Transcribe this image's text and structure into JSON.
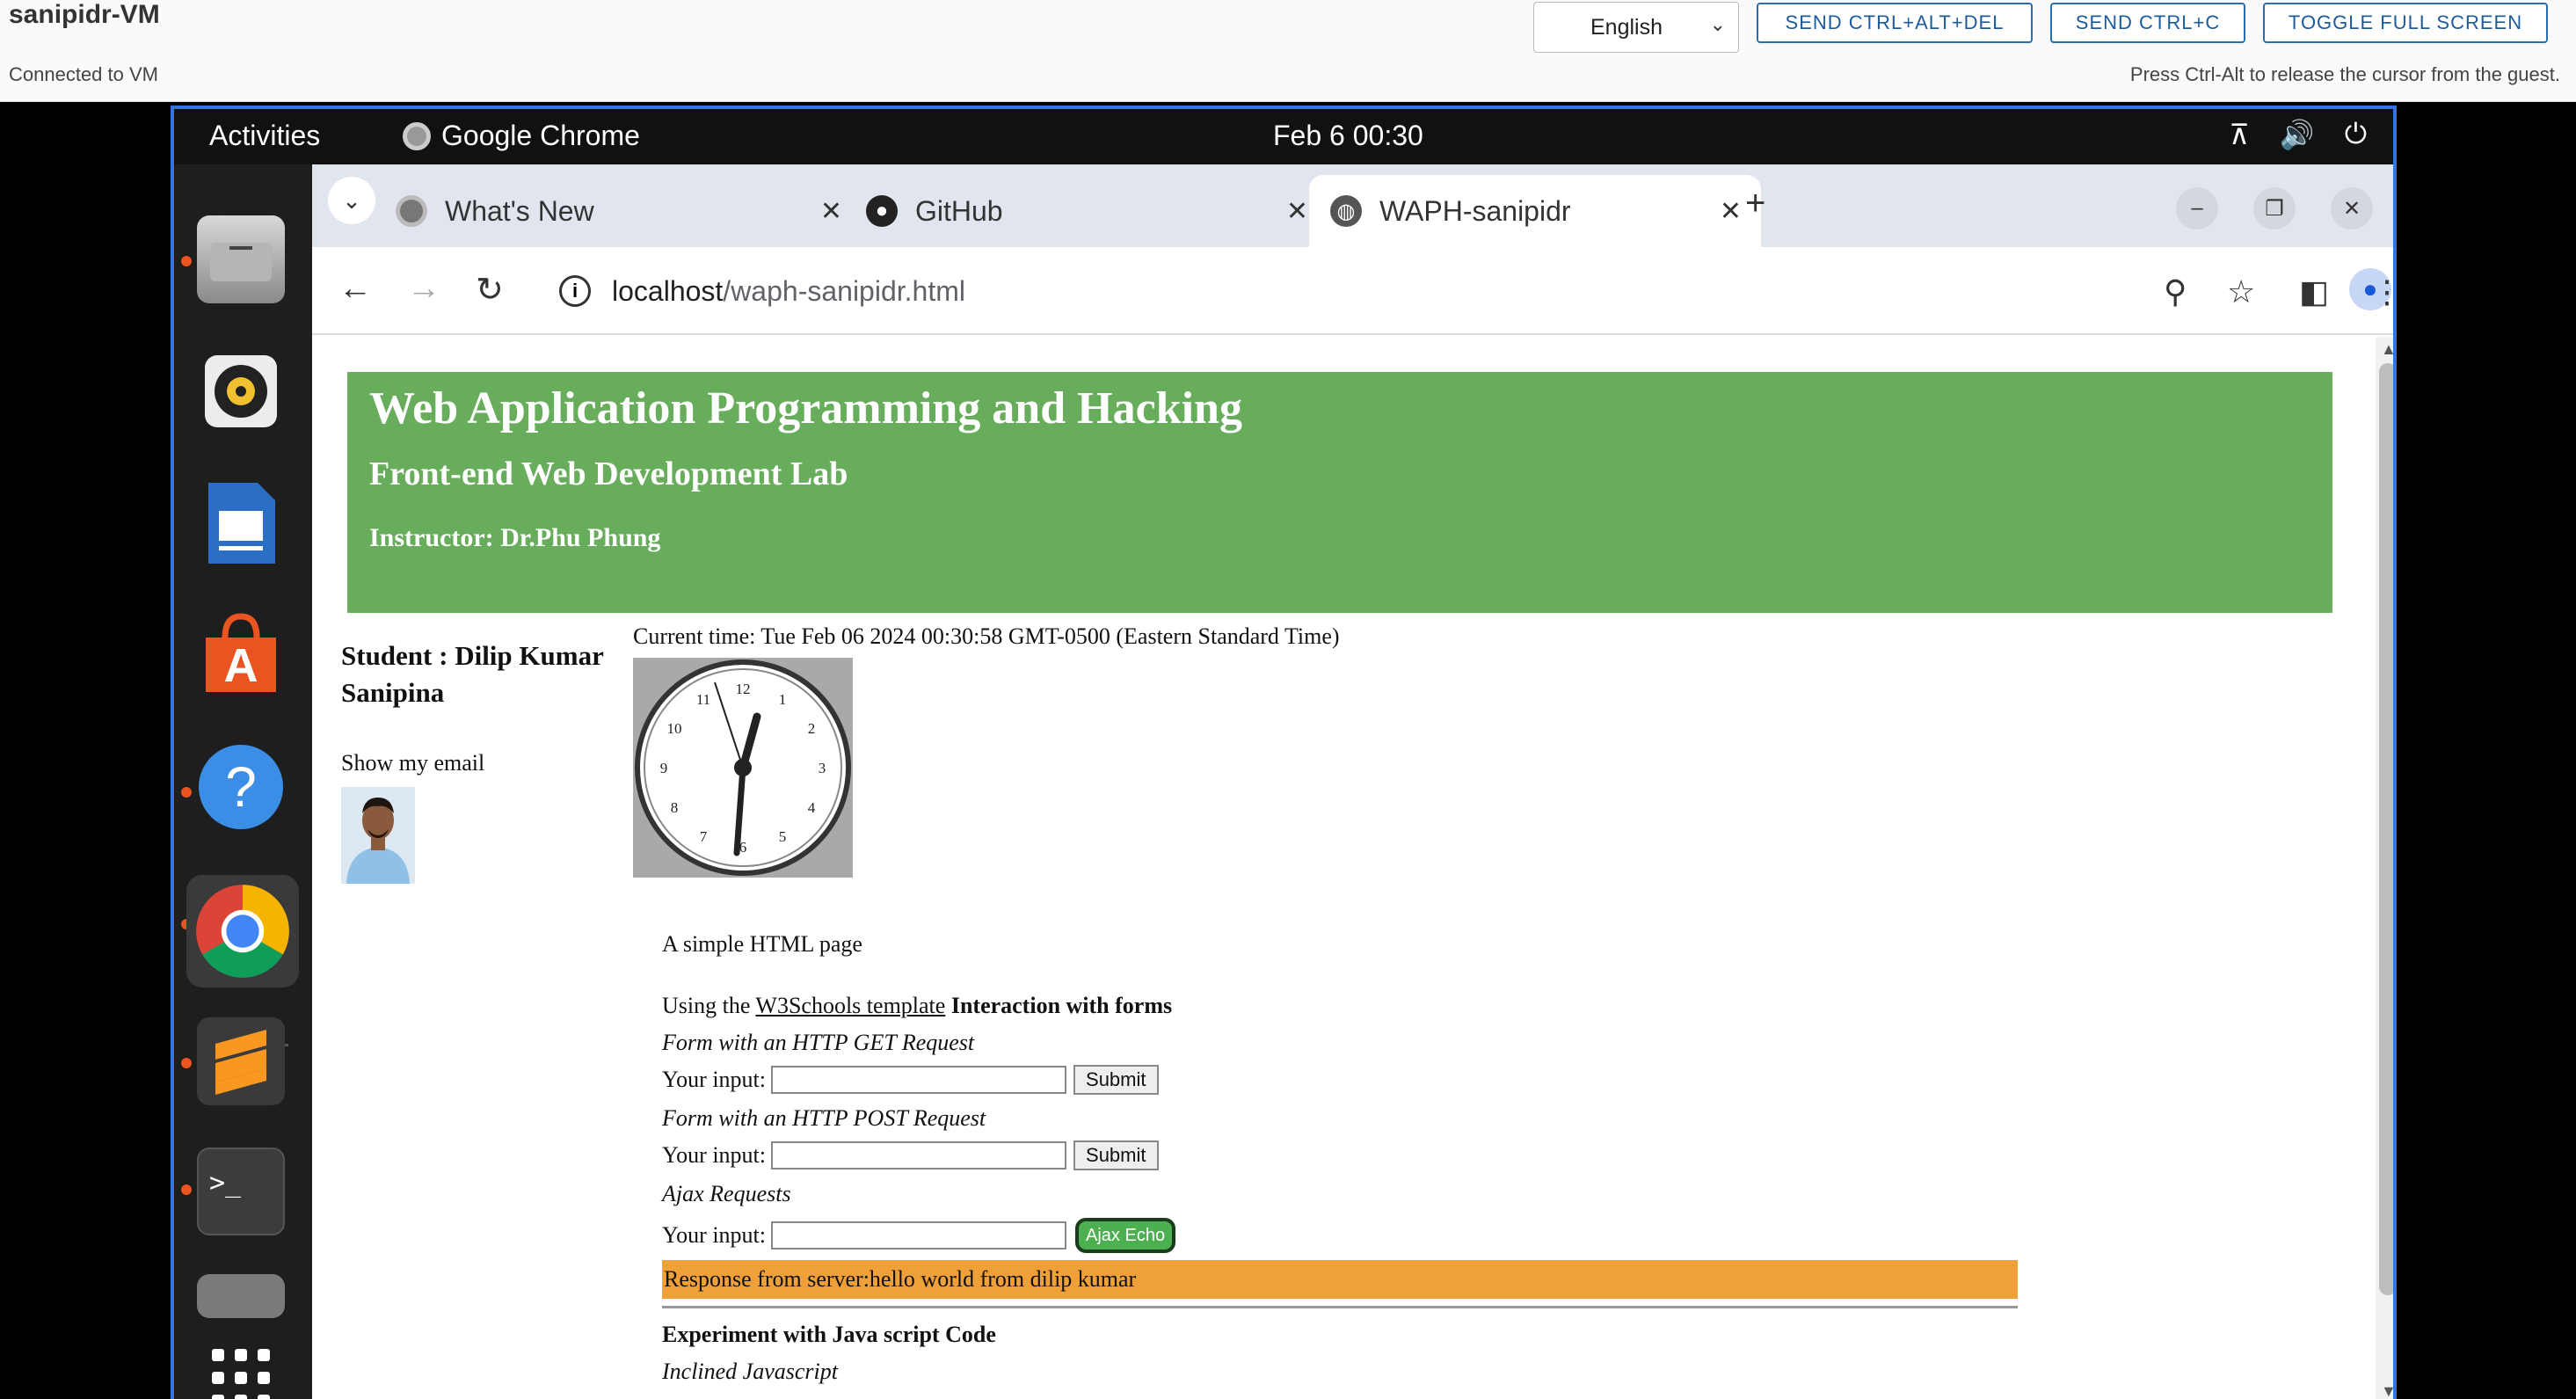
{
  "vm": {
    "title": "sanipidr-VM",
    "status": "Connected to VM",
    "language": "English",
    "buttons": {
      "ctrl_alt_del": "SEND CTRL+ALT+DEL",
      "ctrl_c": "SEND CTRL+C",
      "fullscreen": "TOGGLE FULL SCREEN"
    },
    "hint": "Press Ctrl-Alt to release the cursor from the guest."
  },
  "gnome": {
    "activities": "Activities",
    "app_name": "Google Chrome",
    "clock": "Feb 6  00:30"
  },
  "dock": {
    "items": [
      "files-icon",
      "rhythmbox-icon",
      "writer-icon",
      "software-center-icon",
      "help-icon",
      "chrome-icon",
      "sublime-text-icon",
      "terminal-icon",
      "trash-icon",
      "show-apps-icon"
    ]
  },
  "chrome": {
    "tabs": [
      {
        "label": "What's New",
        "icon": "chrome-icon"
      },
      {
        "label": "GitHub",
        "icon": "github-icon"
      },
      {
        "label": "WAPH-sanipidr",
        "icon": "globe-icon",
        "active": true
      }
    ],
    "url_host": "localhost",
    "url_path": "/waph-sanipidr.html"
  },
  "page": {
    "h1": "Web Application Programming and Hacking",
    "h2": "Front-end Web Development Lab",
    "h3": "Instructor: Dr.Phu Phung",
    "student": "Student : Dilip Kumar Sanipina",
    "show_email": "Show my email",
    "current_time": "Current time: Tue Feb 06 2024 00:30:58 GMT-0500 (Eastern Standard Time)",
    "clock_numbers": [
      "12",
      "1",
      "2",
      "3",
      "4",
      "5",
      "6",
      "7",
      "8",
      "9",
      "10",
      "11"
    ],
    "simple_page": "A simple HTML page",
    "using_the": "Using the ",
    "w3_link": "W3Schools template",
    "interaction": " Interaction with forms",
    "get_title": "Form with an HTTP GET Request",
    "post_title": "Form with an HTTP POST Request",
    "ajax_title": "Ajax Requests",
    "input_label": "Your input:",
    "submit_label": "Submit",
    "ajax_button": "Ajax Echo",
    "response": "Response from server:hello world from dilip kumar",
    "experiment": "Experiment with Java script Code",
    "inclined": "Inclined Javascript"
  },
  "colors": {
    "header_green": "#67ad5b",
    "response_orange": "#f0a038",
    "accent_blue": "#3574e0",
    "ubuntu_orange": "#e95420"
  }
}
